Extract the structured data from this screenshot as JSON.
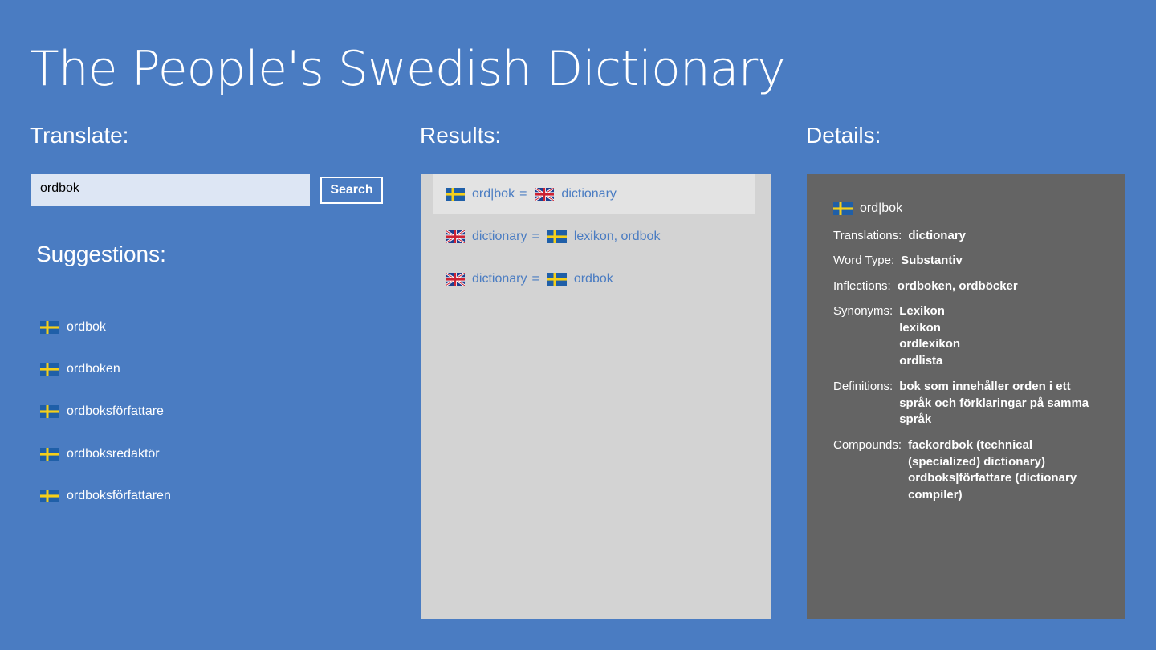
{
  "app": {
    "title": "The People's Swedish Dictionary"
  },
  "headings": {
    "translate": "Translate:",
    "results": "Results:",
    "details": "Details:",
    "suggestions": "Suggestions:"
  },
  "search": {
    "value": "ordbok",
    "button_label": "Search"
  },
  "suggestions": [
    {
      "lang": "sv",
      "text": "ordbok"
    },
    {
      "lang": "sv",
      "text": "ordboken"
    },
    {
      "lang": "sv",
      "text": "ordboksförfattare"
    },
    {
      "lang": "sv",
      "text": "ordboksredaktör"
    },
    {
      "lang": "sv",
      "text": "ordboksförfattaren"
    }
  ],
  "results": [
    {
      "from_lang": "sv",
      "from": "ord|bok",
      "eq": "=",
      "to_lang": "en",
      "to": "dictionary",
      "selected": true
    },
    {
      "from_lang": "en",
      "from": "dictionary",
      "eq": "=",
      "to_lang": "sv",
      "to": "lexikon, ordbok",
      "selected": false
    },
    {
      "from_lang": "en",
      "from": "dictionary",
      "eq": "=",
      "to_lang": "sv",
      "to": "ordbok",
      "selected": false
    }
  ],
  "details": {
    "word_lang": "sv",
    "word": "ord|bok",
    "translations_label": "Translations:",
    "translations": [
      "dictionary"
    ],
    "word_type_label": "Word Type:",
    "word_type": [
      "Substantiv"
    ],
    "inflections_label": "Inflections:",
    "inflections": [
      "ordboken, ordböcker"
    ],
    "synonyms_label": "Synonyms:",
    "synonyms": [
      "Lexikon",
      "lexikon",
      "ordlexikon",
      "ordlista"
    ],
    "definitions_label": "Definitions:",
    "definitions": [
      "bok som innehåller orden i ett",
      "språk och förklaringar på samma",
      "språk"
    ],
    "compounds_label": "Compounds:",
    "compounds": [
      "fackordbok (technical",
      "(specialized) dictionary)",
      "ordboks|författare (dictionary",
      "compiler)"
    ]
  },
  "colors": {
    "background": "#4a7cc2",
    "results_panel": "#d3d3d3",
    "results_selected": "#e3e3e3",
    "details_panel": "#646464",
    "input_background": "#dde6f4",
    "link_text": "#4a7cc2"
  },
  "icons": {
    "sv": "swedish-flag-icon",
    "en": "uk-flag-icon"
  }
}
